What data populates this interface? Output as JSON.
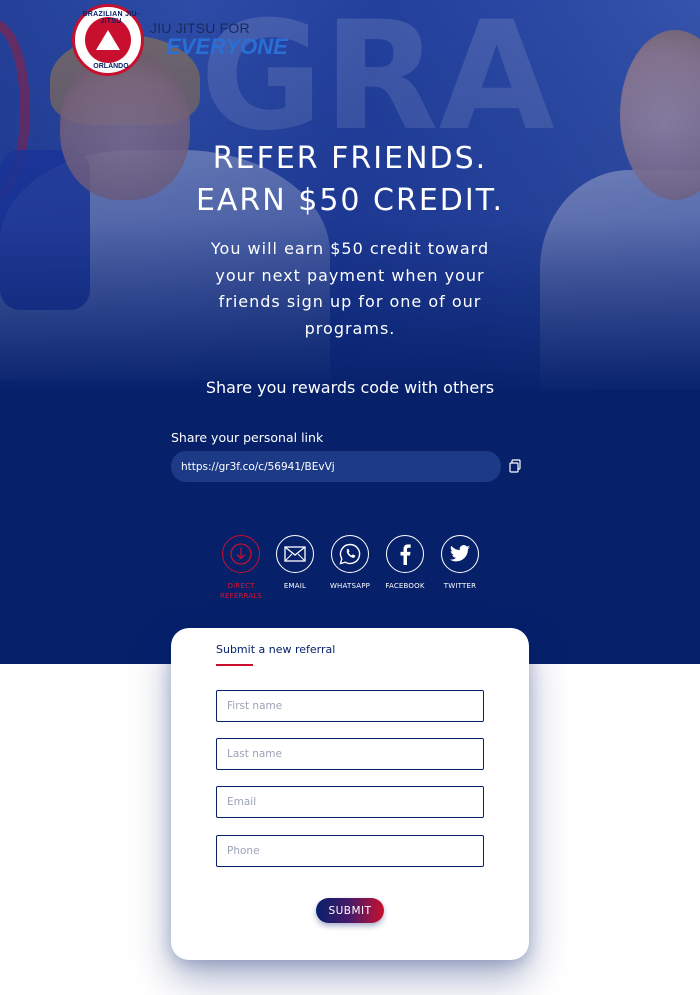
{
  "logo": {
    "ring_top": "BRAZILIAN JIU-JITSU",
    "ring_bottom": "ORLANDO",
    "tagline_top": "JIU JITSU FOR",
    "tagline_bottom": "EVERYONE"
  },
  "hero": {
    "headline_line1": "REFER FRIENDS.",
    "headline_line2": "EARN $50 CREDIT.",
    "subline": "You will earn $50 credit toward your next payment when your friends sign up for one of our programs.",
    "share_title": "Share you rewards code with others",
    "link_label": "Share your personal link",
    "link_value": "https://gr3f.co/c/56941/BEvVj"
  },
  "share_buttons": [
    {
      "label_line1": "DIRECT",
      "label_line2": "REFERRALS",
      "icon": "download-icon",
      "active": true
    },
    {
      "label_line1": "EMAIL",
      "label_line2": "",
      "icon": "envelope-icon",
      "active": false
    },
    {
      "label_line1": "WHATSAPP",
      "label_line2": "",
      "icon": "whatsapp-icon",
      "active": false
    },
    {
      "label_line1": "FACEBOOK",
      "label_line2": "",
      "icon": "facebook-icon",
      "active": false
    },
    {
      "label_line1": "TWITTER",
      "label_line2": "",
      "icon": "twitter-icon",
      "active": false
    }
  ],
  "form": {
    "title": "Submit a new referral",
    "first_name_placeholder": "First name",
    "last_name_placeholder": "Last name",
    "email_placeholder": "Email",
    "phone_placeholder": "Phone",
    "submit_label": "SUBMIT"
  },
  "colors": {
    "brand_navy": "#06206a",
    "brand_red": "#c8102e",
    "accent_blue": "#2a6fd6"
  }
}
